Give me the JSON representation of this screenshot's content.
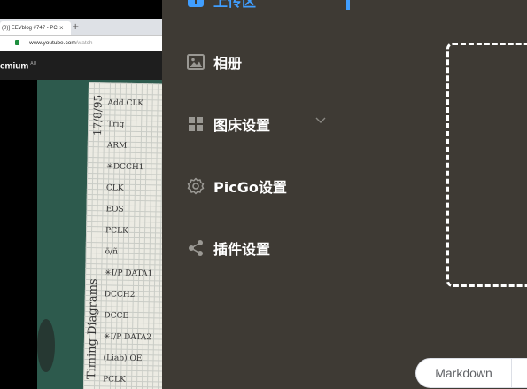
{
  "browser": {
    "tab_title": "(0)] EEVblog #747 - PC",
    "tab_close": "×",
    "new_tab": "+",
    "url_host": "www.youtube.com",
    "url_path": "/watch"
  },
  "youtube": {
    "brand": "emium",
    "region": "AU"
  },
  "notes": {
    "date": "17/8/95",
    "side_title": "Timing Diagrams",
    "lines": [
      "Add.CLK",
      "Trig",
      "ARM",
      "✳DCCH1",
      "CLK",
      "EOS",
      "PCLK",
      "ō/ñ",
      "✳I/P DATA1",
      "DCCH2",
      "DCCE",
      "✳I/P DATA2",
      "(Liab) OE",
      "PCLK"
    ]
  },
  "sidebar": {
    "top_item": "上传区",
    "items": [
      {
        "label": "相册",
        "icon": "image-icon"
      },
      {
        "label": "图床设置",
        "icon": "grid-icon",
        "expandable": true
      },
      {
        "label": "PicGo设置",
        "icon": "gear-icon"
      },
      {
        "label": "插件设置",
        "icon": "share-icon"
      }
    ]
  },
  "main": {
    "format_options": [
      "Markdown",
      ""
    ]
  },
  "colors": {
    "background": "#3e3a34",
    "accent": "#409eff"
  }
}
